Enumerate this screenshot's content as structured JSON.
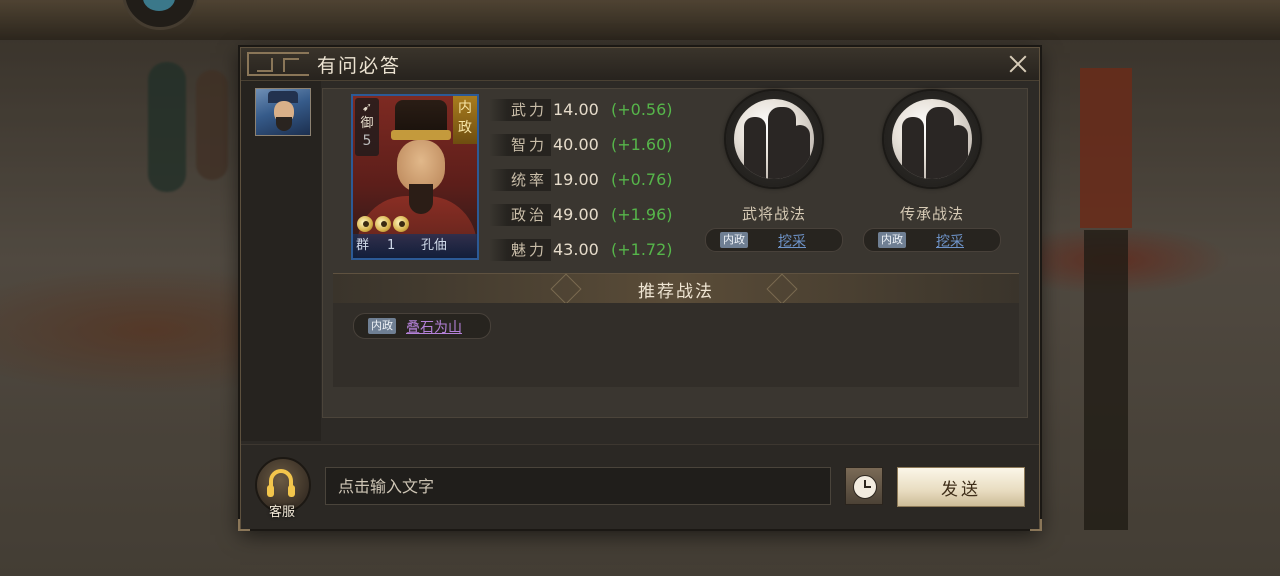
{
  "dialog": {
    "title": "有问必答",
    "close_icon": "close-icon"
  },
  "character": {
    "type_label": "御",
    "cost": "5",
    "role": "内政",
    "faction": "群",
    "level": "1",
    "name": "孔伷",
    "stars": 3
  },
  "stats": [
    {
      "label": "武力",
      "value": "14.00",
      "growth": "(+0.56)"
    },
    {
      "label": "智力",
      "value": "40.00",
      "growth": "(+1.60)"
    },
    {
      "label": "统率",
      "value": "19.00",
      "growth": "(+0.76)"
    },
    {
      "label": "政治",
      "value": "49.00",
      "growth": "(+1.96)"
    },
    {
      "label": "魅力",
      "value": "43.00",
      "growth": "(+1.72)"
    }
  ],
  "tactics": [
    {
      "title": "武将战法",
      "tag": "内政",
      "name": "挖采"
    },
    {
      "title": "传承战法",
      "tag": "内政",
      "name": "挖采"
    }
  ],
  "recommend": {
    "title": "推荐战法",
    "items": [
      {
        "tag": "内政",
        "name": "叠石为山"
      }
    ]
  },
  "bottom": {
    "cs_label": "客服",
    "input_placeholder": "点击输入文字",
    "send_label": "发送"
  },
  "colors": {
    "growth": "#56b64a",
    "tactic_link": "#6e93c8",
    "recommend_link": "#b481d8"
  }
}
